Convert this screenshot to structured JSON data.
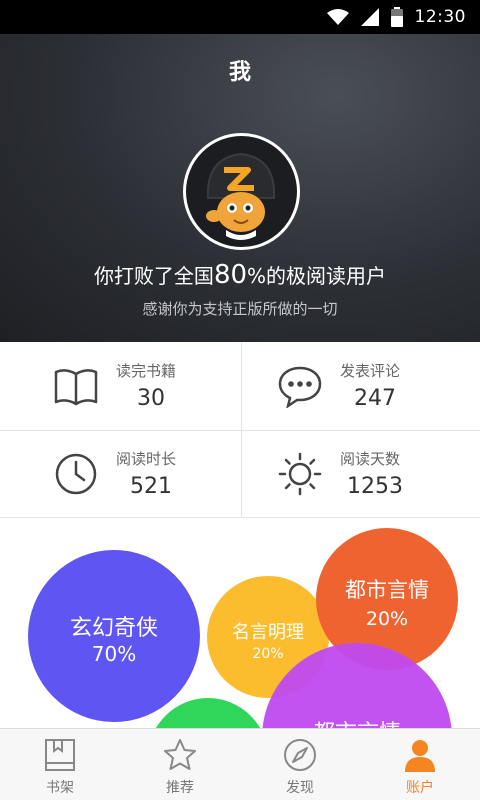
{
  "status_bar": {
    "time": "12:30"
  },
  "header": {
    "title": "我",
    "beat_prefix": "你打败了全国",
    "beat_percent": "80",
    "beat_suffix": "%的极阅读用户",
    "thanks": "感谢你为支持正版所做的一切"
  },
  "stats": [
    {
      "label": "读完书籍",
      "value": "30",
      "icon": "book-icon"
    },
    {
      "label": "发表评论",
      "value": "247",
      "icon": "comment-icon"
    },
    {
      "label": "阅读时长",
      "value": "521",
      "icon": "clock-icon"
    },
    {
      "label": "阅读天数",
      "value": "1253",
      "icon": "sun-icon"
    }
  ],
  "bubbles": [
    {
      "name": "玄幻奇侠",
      "percent": "70%",
      "color": "#5f55f2"
    },
    {
      "name": "名言明理",
      "percent": "20%",
      "color": "#fbbc2e"
    },
    {
      "name": "都市言情",
      "percent": "20%",
      "color": "#ef6331"
    },
    {
      "name": "都市言情",
      "percent": "",
      "color": "#c04af0"
    },
    {
      "name": "",
      "percent": "",
      "color": "#2fd65a"
    }
  ],
  "tabs": [
    {
      "label": "书架",
      "icon": "bookshelf-icon",
      "active": false
    },
    {
      "label": "推荐",
      "icon": "star-icon",
      "active": false
    },
    {
      "label": "发现",
      "icon": "compass-icon",
      "active": false
    },
    {
      "label": "账户",
      "icon": "account-icon",
      "active": true
    }
  ],
  "colors": {
    "accent": "#f5861f",
    "header_bg": "#2c2f35"
  }
}
